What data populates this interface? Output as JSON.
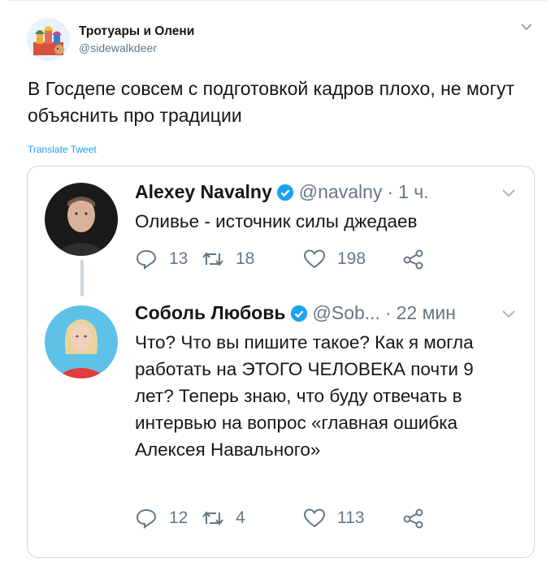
{
  "tweet": {
    "author_name": "Тротуары и Олени",
    "author_handle": "@sidewalkdeer",
    "text": "В Госдепе совсем с подготовкой кадров плохо, не могут объяснить про традиции",
    "translate_label": "Translate Tweet"
  },
  "quoted": [
    {
      "name": "Alexey Navalny",
      "handle": "@navalny",
      "time": "1 ч.",
      "text": "Оливье - источник силы джедаев",
      "replies": "13",
      "retweets": "18",
      "likes": "198"
    },
    {
      "name": "Соболь Любовь",
      "handle": "@Sob...",
      "time": "22 мин",
      "text": "Что? Что вы пишите такое? Как я могла работать на ЭТОГО ЧЕЛОВЕКА почти 9 лет? Теперь знаю, что буду отвечать в интервью на вопрос «главная ошибка Алексея Навального»",
      "replies": "12",
      "retweets": "4",
      "likes": "113"
    }
  ],
  "icons": {
    "verified": "verified-badge-icon",
    "reply": "reply-icon",
    "retweet": "retweet-icon",
    "like": "heart-icon",
    "share": "share-icon",
    "caret": "chevron-down-icon"
  },
  "colors": {
    "accent": "#1da1f2",
    "muted": "#657786",
    "border": "#ccd6dd",
    "text": "#14171a"
  }
}
